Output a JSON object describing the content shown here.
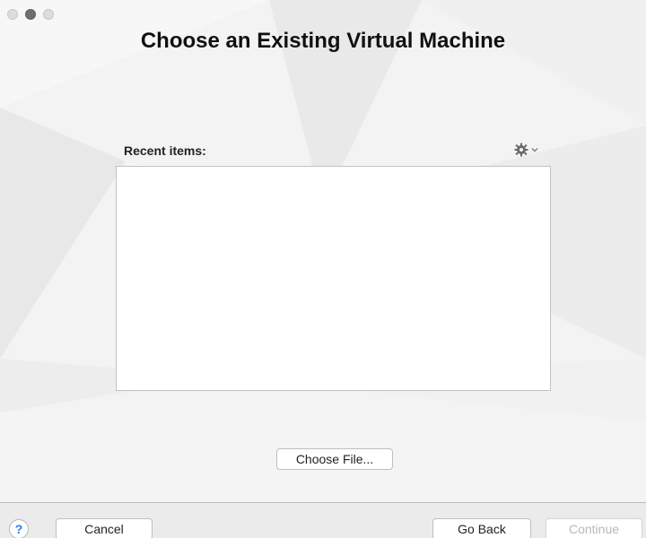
{
  "window": {
    "title": "Choose an Existing Virtual Machine"
  },
  "recent": {
    "label": "Recent items:",
    "items": []
  },
  "buttons": {
    "choose_file": "Choose File...",
    "cancel": "Cancel",
    "go_back": "Go Back",
    "continue": "Continue",
    "help": "?"
  },
  "icons": {
    "gear": "gear-icon",
    "chevron": "chevron-down-icon"
  },
  "colors": {
    "help_accent": "#2a7de1",
    "disabled_text": "#b8b8b8"
  }
}
